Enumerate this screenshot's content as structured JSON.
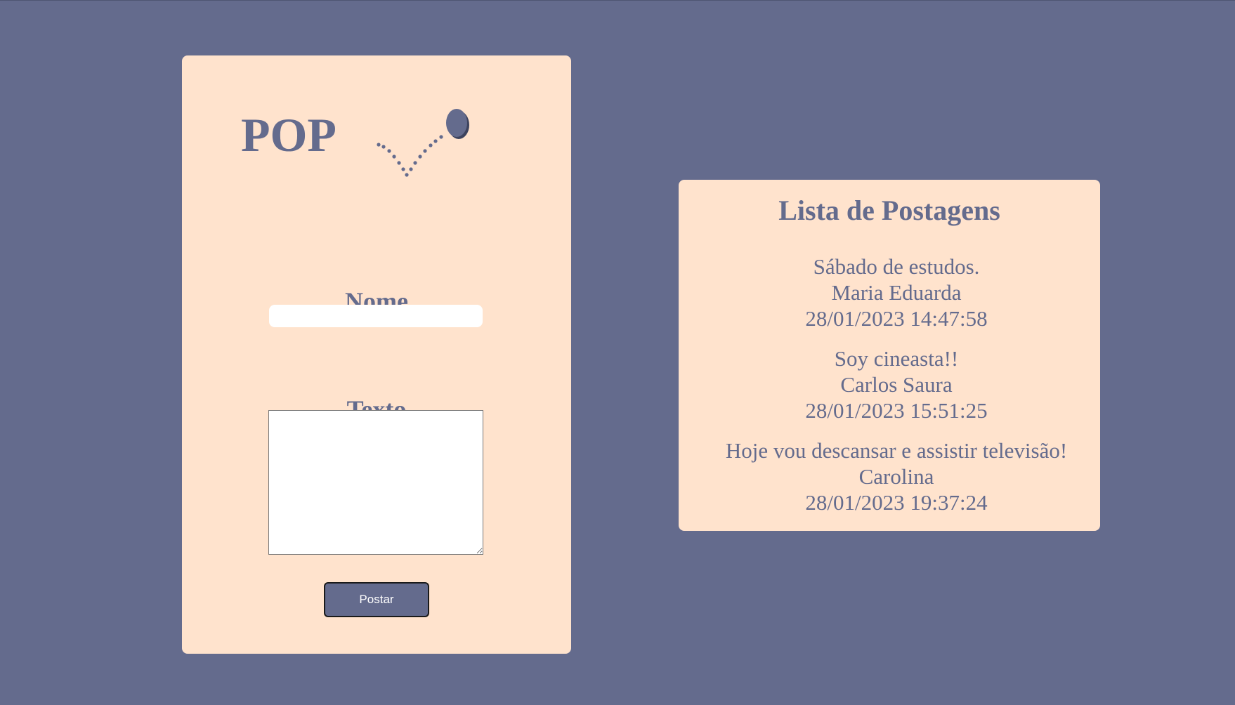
{
  "theme": {
    "background": "#646b8d",
    "card": "#ffe3cd",
    "accent": "#646b8d",
    "button_text": "#ffffff"
  },
  "form": {
    "logo_text": "POP",
    "logo_icon": "bouncing-ball-icon",
    "name_label": "Nome",
    "name_value": "",
    "text_label": "Texto",
    "text_value": "",
    "submit_label": "Postar"
  },
  "posts": {
    "title": "Lista de Postagens",
    "items": [
      {
        "text": "Sábado de estudos.",
        "author": "Maria Eduarda",
        "timestamp": "28/01/2023 14:47:58"
      },
      {
        "text": "Soy cineasta!!",
        "author": "Carlos Saura",
        "timestamp": "28/01/2023 15:51:25"
      },
      {
        "text": "Hoje vou descansar e assistir televisão!",
        "author": "Carolina",
        "timestamp": "28/01/2023 19:37:24"
      }
    ]
  }
}
